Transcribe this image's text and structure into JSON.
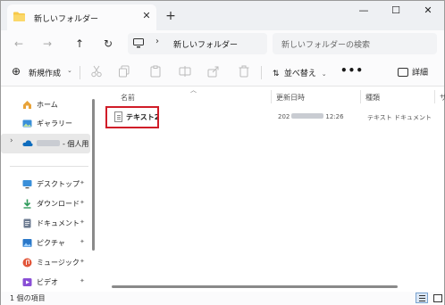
{
  "tab": {
    "title": "新しいフォルダー",
    "close_label": "✕",
    "new_label": "+"
  },
  "window": {
    "minimize": "—",
    "maximize": "☐",
    "close": "✕"
  },
  "nav": {
    "back": "←",
    "forward": "→",
    "up": "↑",
    "refresh": "↻",
    "chevron": "›",
    "path": "新しいフォルダー",
    "search_placeholder": "新しいフォルダーの検索"
  },
  "toolbar": {
    "new_label": "新規作成",
    "new_plus": "⊕",
    "new_dropdown": "⌄",
    "sort_label": "並べ替え",
    "sort_dropdown": "⌄",
    "more_label": "•••",
    "details_label": "詳細"
  },
  "sidebar": {
    "items": [
      {
        "label": "ホーム",
        "icon": "home-icon"
      },
      {
        "label": "ギャラリー",
        "icon": "gallery-icon"
      },
      {
        "label": "- 個人用",
        "icon": "onedrive-icon"
      },
      {
        "label": "デスクトップ",
        "icon": "desktop-icon"
      },
      {
        "label": "ダウンロード",
        "icon": "download-icon"
      },
      {
        "label": "ドキュメント",
        "icon": "documents-icon"
      },
      {
        "label": "ピクチャ",
        "icon": "pictures-icon"
      },
      {
        "label": "ミュージック",
        "icon": "music-icon"
      },
      {
        "label": "ビデオ",
        "icon": "videos-icon"
      }
    ],
    "chevron": "›",
    "pin": "📌"
  },
  "columns": {
    "name": "名前",
    "date": "更新日時",
    "type": "種類",
    "size": "サ"
  },
  "files": [
    {
      "name": "テキスト2",
      "date_prefix": "202",
      "time": "12:26",
      "type": "テキスト ドキュメント"
    }
  ],
  "status": {
    "count": "1 個の項目"
  },
  "colors": {
    "highlight": "#d01c28",
    "folder": "#f7c948",
    "onedrive": "#0f6cbd"
  }
}
